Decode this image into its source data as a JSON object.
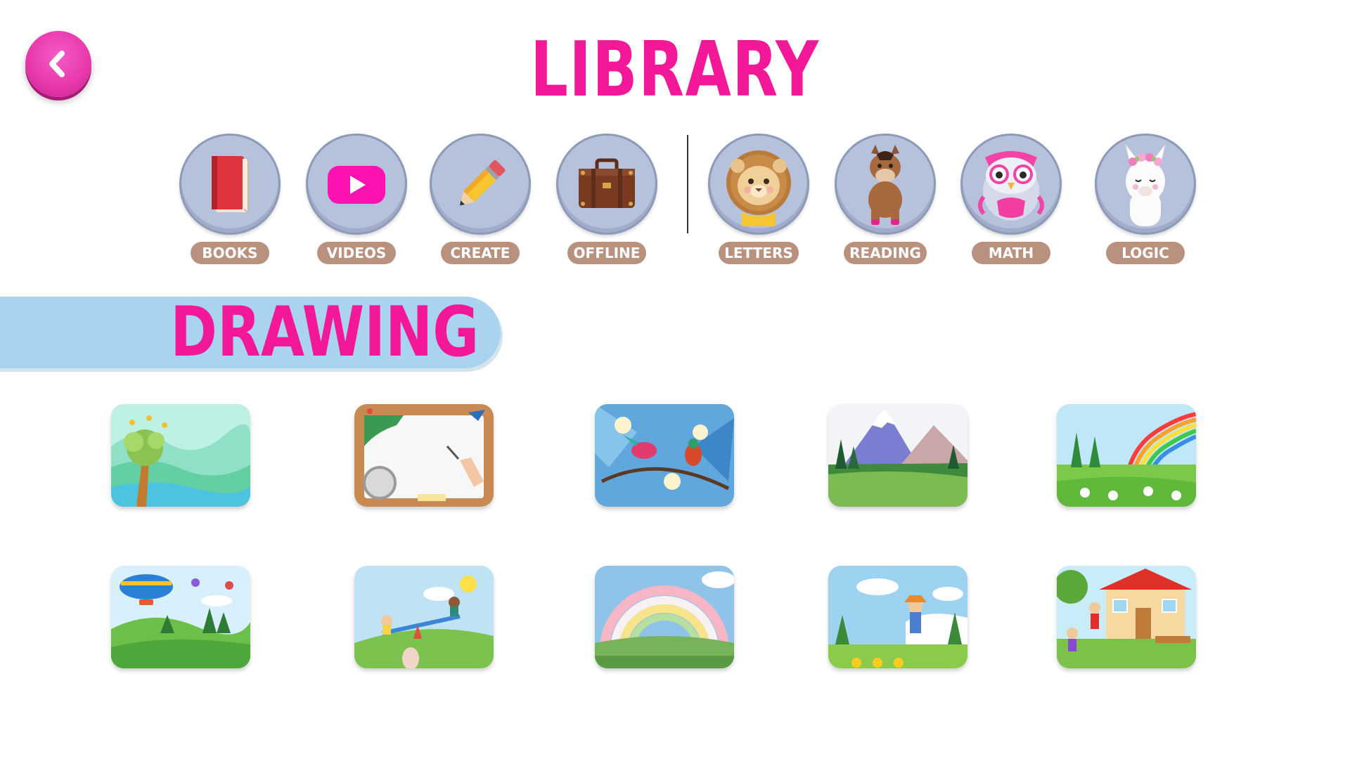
{
  "header": {
    "title": "LIBRARY",
    "back_icon": "chevron-left-icon"
  },
  "categories": [
    {
      "label": "BOOKS",
      "icon": "red-book-icon"
    },
    {
      "label": "VIDEOS",
      "icon": "video-play-icon"
    },
    {
      "label": "CREATE",
      "icon": "pencil-icon"
    },
    {
      "label": "OFFLINE",
      "icon": "suitcase-icon"
    },
    {
      "label": "LETTERS",
      "icon": "lion-icon"
    },
    {
      "label": "READING",
      "icon": "horse-icon"
    },
    {
      "label": "MATH",
      "icon": "owl-icon"
    },
    {
      "label": "LOGIC",
      "icon": "llama-icon"
    }
  ],
  "section": {
    "title": "DRAWING"
  },
  "thumbnails": [
    {
      "name": "palm-meadow-thumbnail"
    },
    {
      "name": "drawing-board-thumbnail"
    },
    {
      "name": "birds-flowers-thumbnail"
    },
    {
      "name": "mountain-lake-thumbnail"
    },
    {
      "name": "rainbow-field-thumbnail"
    },
    {
      "name": "airship-hills-thumbnail"
    },
    {
      "name": "seesaw-kids-thumbnail"
    },
    {
      "name": "pastel-rainbow-thumbnail"
    },
    {
      "name": "boy-gardening-thumbnail"
    },
    {
      "name": "house-kids-thumbnail"
    }
  ],
  "colors": {
    "accent_pink": "#f21897",
    "banner_blue": "#a9d3ef",
    "category_circle": "#b6c1dc",
    "category_label_bg": "#b8917f"
  }
}
